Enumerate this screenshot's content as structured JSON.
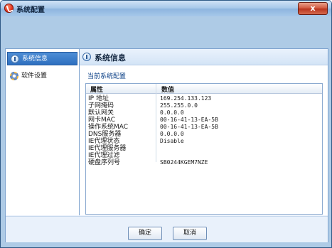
{
  "window": {
    "title": "系统配置",
    "close_label": "x"
  },
  "sidebar": {
    "items": [
      {
        "label": "系统信息",
        "icon": "info-icon",
        "active": true
      },
      {
        "label": "软件设置",
        "icon": "gear-icon",
        "active": false
      }
    ]
  },
  "panel": {
    "title": "系统信息",
    "subtitle": "当前系统配置",
    "columns": [
      "属性",
      "数值"
    ],
    "rows": [
      {
        "prop": "IP 地址",
        "value": "169.254.133.123"
      },
      {
        "prop": "子网掩码",
        "value": "255.255.0.0"
      },
      {
        "prop": "默认网关",
        "value": "0.0.0.0"
      },
      {
        "prop": "网卡MAC",
        "value": "00-16-41-13-EA-5B"
      },
      {
        "prop": "操作系统MAC",
        "value": "00-16-41-13-EA-5B"
      },
      {
        "prop": "DNS服务器",
        "value": "0.0.0.0"
      },
      {
        "prop": "IE代理状态",
        "value": "Disable"
      },
      {
        "prop": "IE代理服务器",
        "value": ""
      },
      {
        "prop": "IE代理过滤",
        "value": ""
      },
      {
        "prop": "硬盘序列号",
        "value": "SB0244KGEM7NZE"
      }
    ]
  },
  "footer": {
    "ok_label": "确定",
    "cancel_label": "取消"
  }
}
